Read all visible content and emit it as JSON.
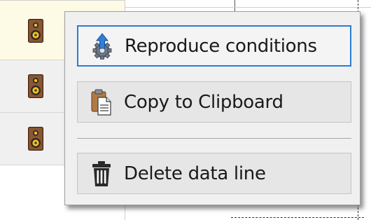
{
  "rows": [
    {
      "icon": "speaker-icon",
      "selected": true
    },
    {
      "icon": "speaker-icon",
      "selected": false
    },
    {
      "icon": "speaker-icon",
      "selected": false
    }
  ],
  "context_menu": {
    "items": [
      {
        "label": "Reproduce conditions",
        "icon": "gear-arrow-icon",
        "focused": true
      },
      {
        "label": "Copy to Clipboard",
        "icon": "clipboard-icon",
        "focused": false
      },
      {
        "label": "Delete data line",
        "icon": "trash-icon",
        "focused": false
      }
    ]
  },
  "colors": {
    "focus_border": "#2b7cd3",
    "selected_row": "#fdfbe5",
    "menu_bg": "#f0f0f0"
  }
}
